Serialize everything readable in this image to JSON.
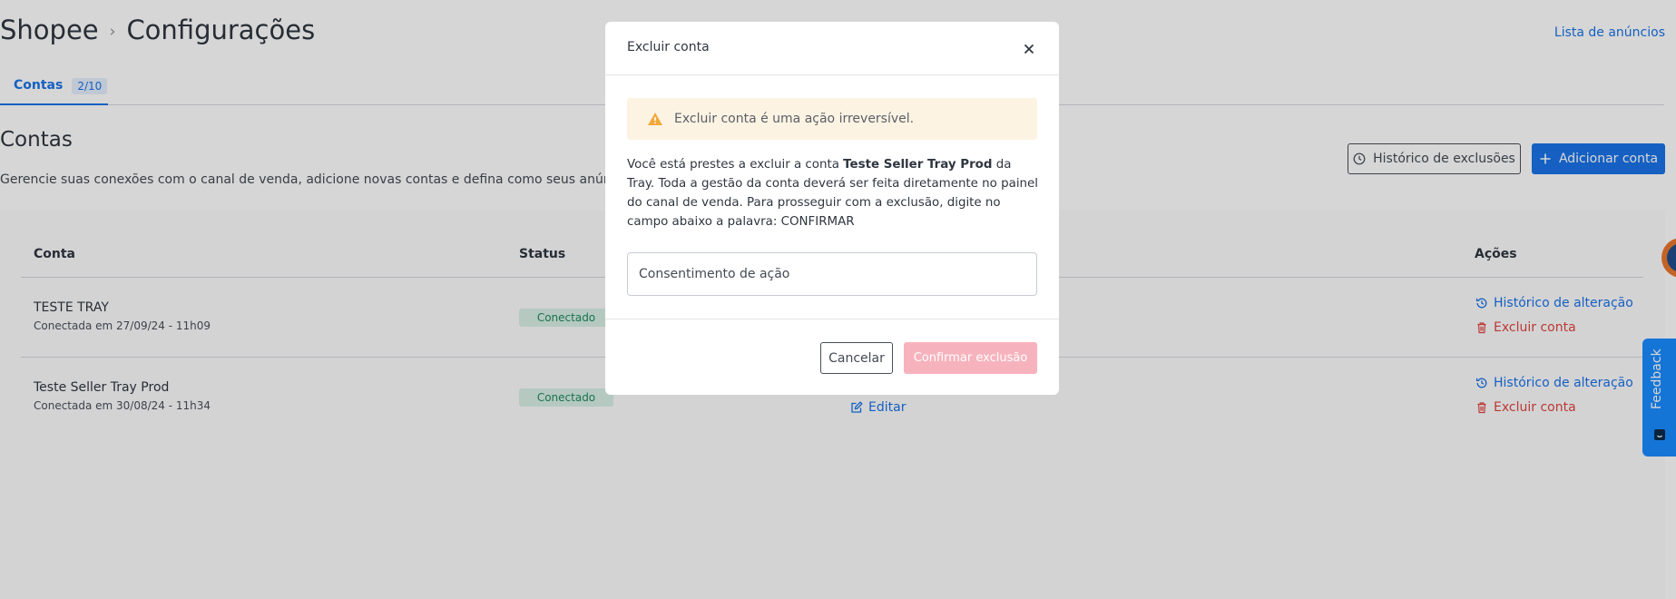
{
  "header": {
    "breadcrumb_root": "Shopee",
    "breadcrumb_separator": "›",
    "breadcrumb_current": "Configurações",
    "top_link": "Lista de anúncios"
  },
  "tabs": [
    {
      "label": "Contas",
      "badge": "2/10",
      "active": true
    }
  ],
  "section": {
    "title": "Contas",
    "description": "Gerencie suas conexões com o canal de venda, adicione novas contas e defina como seus anúncios serão pr",
    "history_button": "Histórico de exclusões",
    "add_button": "Adicionar conta"
  },
  "table": {
    "headers": {
      "account": "Conta",
      "status": "Status",
      "actions": "Ações"
    },
    "rows": [
      {
        "name": "TESTE TRAY",
        "connected": "Conectada em 27/09/24 - 11h09",
        "status": "Conectado",
        "action_history": "Histórico de alteração",
        "action_delete": "Excluir conta"
      },
      {
        "name": "Teste Seller Tray Prod",
        "connected": "Conectada em 30/08/24 - 11h34",
        "status": "Conectado",
        "edit": "Editar",
        "action_history": "Histórico de alteração",
        "action_delete": "Excluir conta"
      }
    ]
  },
  "feedback": {
    "label": "Feedback"
  },
  "modal": {
    "title": "Excluir conta",
    "alert": "Excluir conta é uma ação irreversível.",
    "body_before": "Você está prestes a excluir a conta ",
    "body_account": "Teste Seller Tray Prod",
    "body_after": " da Tray. Toda a gestão da conta deverá ser feita diretamente no painel do canal de venda. Para prosseguir com a exclusão, digite no campo abaixo a palavra: CONFIRMAR",
    "input_placeholder": "Consentimento de ação",
    "input_value": "",
    "cancel_button": "Cancelar",
    "confirm_button": "Confirmar exclusão"
  },
  "colors": {
    "accent": "#1a73e8",
    "danger": "#e0453e",
    "success_bg": "#d8f0e6",
    "warning_bg": "#fdf3e3",
    "confirm_disabled": "#f7b3bd"
  },
  "icons": {
    "close": "close-icon",
    "warning": "warning-icon",
    "history": "history-icon",
    "plus": "plus-icon",
    "trash": "trash-icon",
    "edit": "edit-icon"
  }
}
